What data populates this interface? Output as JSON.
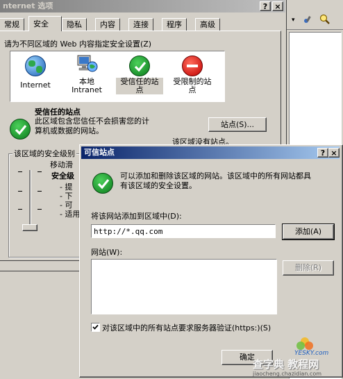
{
  "bg_window": {
    "title": "nternet 选项",
    "tabs": [
      "常规",
      "安全",
      "隐私",
      "内容",
      "连接",
      "程序",
      "高级"
    ],
    "instruction": "请为不同区域的 Web 内容指定安全设置(Z)",
    "zones": [
      {
        "name": "Internet",
        "icon": "globe-icon"
      },
      {
        "name": "本地\nIntranet",
        "icon": "intranet-icon"
      },
      {
        "name": "受信任的站\n点",
        "icon": "check-icon"
      },
      {
        "name": "受限制的站\n点",
        "icon": "no-entry-icon"
      }
    ],
    "zone_info_title": "受信任的站点",
    "zone_info_desc": "此区域包含您信任不会损害您的计\n算机或数据的网站。",
    "sites_button": "站点(S)...",
    "no_sites_text": "该区域没有站点。",
    "security_group_label": "该区域的安全级别",
    "move_slider_text": "移动滑",
    "security_level": "安全级",
    "list_items": [
      "- 提",
      "- 下",
      "- 可",
      "- 适用"
    ]
  },
  "dialog": {
    "title": "可信站点",
    "description": "可以添加和删除该区域的网站。该区域中的所有网站都具\n有该区域的安全设置。",
    "add_label": "将该网站添加到区域中(D):",
    "add_input_value": "http://*.qq.com",
    "add_button": "添加(A)",
    "sites_label": "网站(W):",
    "delete_button": "删除(R)",
    "https_check_label": "对该区域中的所有站点要求服务器验证(https:)(S)",
    "https_checked": true,
    "ok_button": "确定"
  },
  "watermark": {
    "site1": "查字典 教程网",
    "site2": "jiaocheng.chazidian.com",
    "site3": "YESKY.com"
  },
  "icons": {
    "help": "?",
    "close": "×"
  },
  "colors": {
    "title_active": "#0a246a",
    "window_face": "#d4d0c8",
    "check_green": "#0a7a1c",
    "stop_red": "#c00000"
  }
}
